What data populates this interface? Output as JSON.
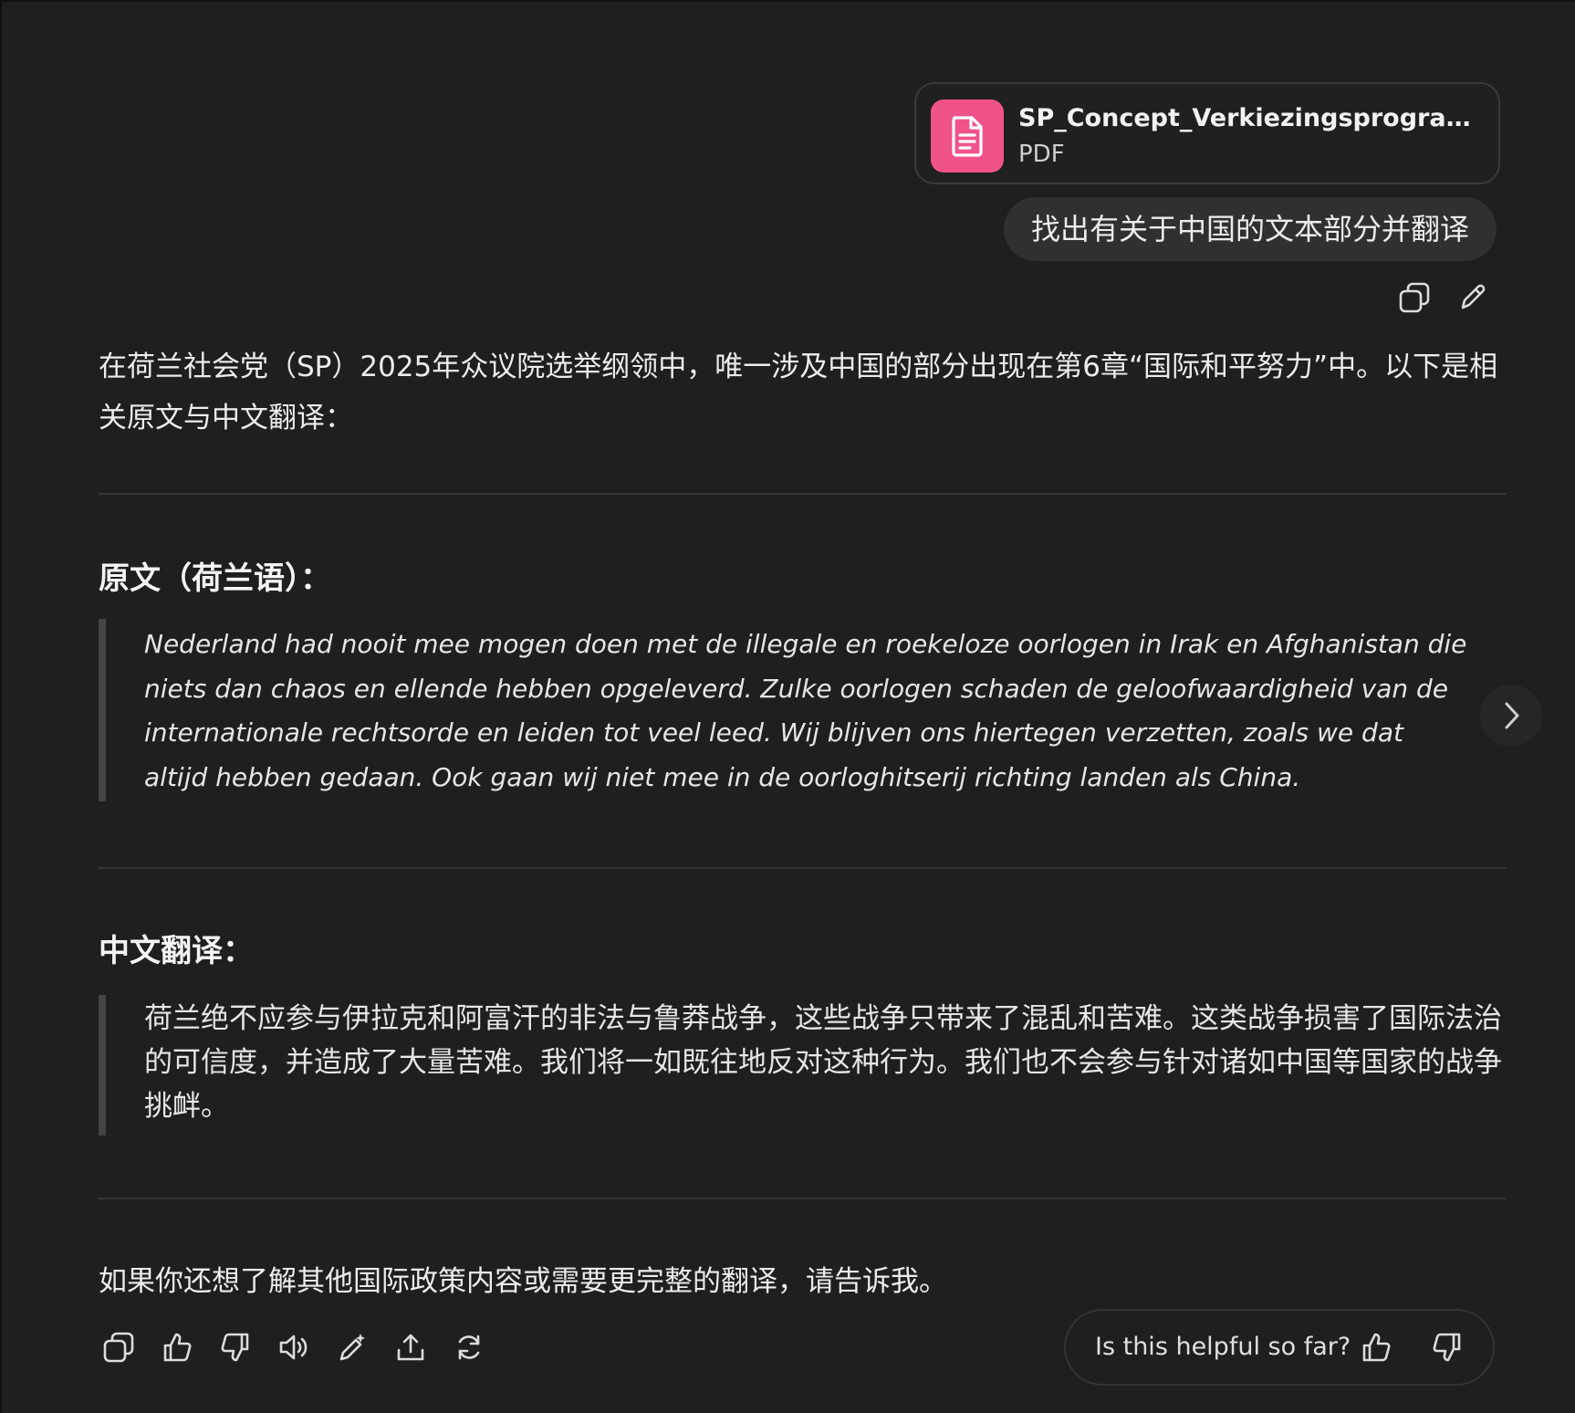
{
  "user_message": {
    "attachment": {
      "file_name": "SP_Concept_Verkiezingsprogramma_T...",
      "file_type": "PDF",
      "icon": "document-icon",
      "icon_color": "#f0538a"
    },
    "text": "找出有关于中国的文本部分并翻译",
    "actions": [
      "copy-icon",
      "edit-icon"
    ]
  },
  "assistant_message": {
    "intro": "在荷兰社会党（SP）2025年众议院选举纲领中，唯一涉及中国的部分出现在第6章“国际和平努力”中。以下是相关原文与中文翻译：",
    "original_heading": "原文（荷兰语）：",
    "original_text": "Nederland had nooit mee mogen doen met de illegale en roekeloze oorlogen in Irak en Afghanistan die niets dan chaos en ellende hebben opgeleverd. Zulke oorlogen schaden de geloofwaardigheid van de internationale rechtsorde en leiden tot veel leed. Wij blijven ons hiertegen verzetten, zoals we dat altijd hebben gedaan. Ook gaan wij niet mee in de oorloghitserij richting landen als China.",
    "translation_heading": "中文翻译：",
    "translation_text": "荷兰绝不应参与伊拉克和阿富汗的非法与鲁莽战争，这些战争只带来了混乱和苦难。这类战争损害了国际法治的可信度，并造成了大量苦难。我们将一如既往地反对这种行为。我们也不会参与针对诸如中国等国家的战争挑衅。",
    "closing": "如果你还想了解其他国际政策内容或需要更完整的翻译，请告诉我。"
  },
  "action_bar": {
    "icons": [
      "copy-icon",
      "thumbs-up-icon",
      "thumbs-down-icon",
      "read-aloud-icon",
      "edit-icon",
      "share-icon",
      "regenerate-icon"
    ]
  },
  "feedback": {
    "question": "Is this helpful so far?",
    "icons": [
      "thumbs-up-icon",
      "thumbs-down-icon"
    ]
  },
  "navigation": {
    "next_icon": "chevron-right-icon"
  }
}
